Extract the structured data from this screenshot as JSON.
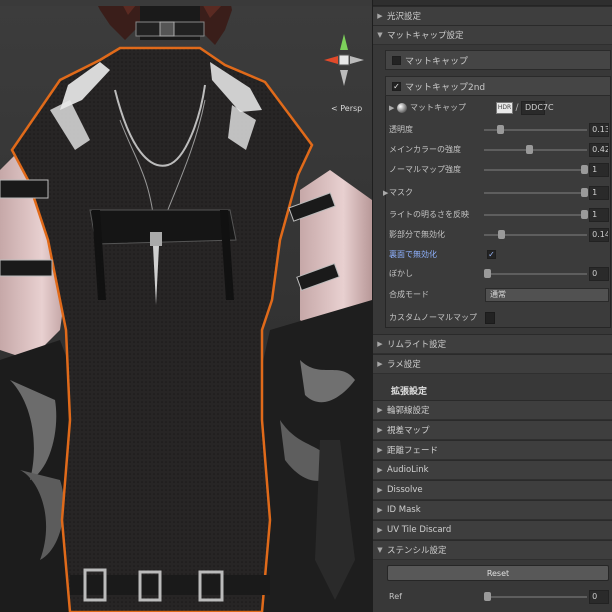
{
  "scene": {
    "view_mode_label": "< Persp",
    "gizmo_axes": [
      "y",
      "x",
      "z"
    ]
  },
  "inspector": {
    "top_foldouts": [
      {
        "label": "光沢設定",
        "arrow": "▶"
      },
      {
        "label": "マットキャップ設定",
        "arrow": "▼"
      }
    ],
    "matcap1": {
      "label": "マットキャップ",
      "checked": false
    },
    "matcap2": {
      "label": "マットキャップ2nd",
      "checked": true,
      "texture_row": {
        "arrow": "▶",
        "label": "マットキャップ",
        "hdr": "HDR",
        "color_hex": "DDC7C"
      },
      "properties": [
        {
          "label": "透明度",
          "value": "0.13",
          "fraction": 0.13
        },
        {
          "label": "メインカラーの強度",
          "value": "0.427",
          "fraction": 0.427
        },
        {
          "label": "ノーマルマップ強度",
          "value": "1",
          "fraction": 1.0
        },
        {
          "label": "マスク",
          "value": "1",
          "fraction": 1.0
        },
        {
          "label": "ライトの明るさを反映",
          "value": "1",
          "fraction": 1.0
        },
        {
          "label": "影部分で無効化",
          "value": "0.145",
          "fraction": 0.145
        }
      ],
      "backface": {
        "label": "裏面で無効化",
        "checked": true
      },
      "blur": {
        "label": "ぼかし",
        "value": "0",
        "fraction": 0.0
      },
      "blend_mode": {
        "label": "合成モード",
        "value": "通常"
      },
      "custom_normal": {
        "label": "カスタムノーマルマップ",
        "checked": false
      }
    },
    "mid_foldouts": [
      {
        "label": "リムライト設定",
        "arrow": "▶"
      },
      {
        "label": "ラメ設定",
        "arrow": "▶"
      }
    ],
    "extended_section": "拡張設定",
    "ext_foldouts": [
      {
        "label": "輪郭線設定",
        "arrow": "▶"
      },
      {
        "label": "視差マップ",
        "arrow": "▶"
      },
      {
        "label": "距離フェード",
        "arrow": "▶"
      },
      {
        "label": "AudioLink",
        "arrow": "▶"
      },
      {
        "label": "Dissolve",
        "arrow": "▶"
      },
      {
        "label": "ID Mask",
        "arrow": "▶"
      },
      {
        "label": "UV Tile Discard",
        "arrow": "▶"
      },
      {
        "label": "ステンシル設定",
        "arrow": "▼"
      }
    ],
    "stencil": {
      "reset_label": "Reset",
      "ref": {
        "label": "Ref",
        "value": "0",
        "fraction": 0.0
      }
    }
  }
}
